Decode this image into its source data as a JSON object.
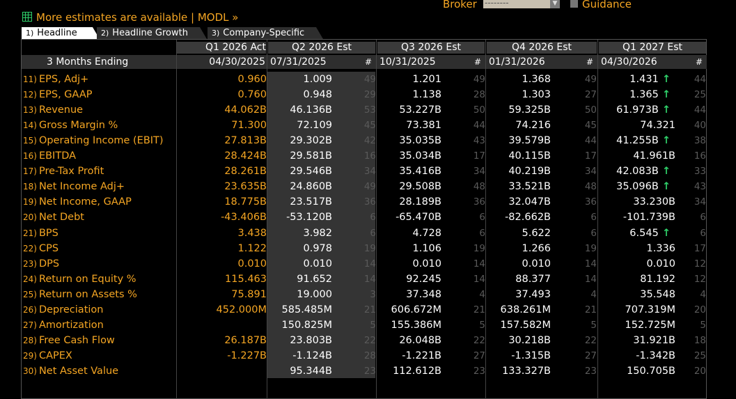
{
  "topbar": {
    "more_link": "More estimates are available | MODL »",
    "broker_label": "Broker",
    "broker_value": "--------",
    "guidance_label": "Guidance"
  },
  "tabs": [
    {
      "num": "1)",
      "label": "Headline"
    },
    {
      "num": "2)",
      "label": "Headline Growth"
    },
    {
      "num": "3)",
      "label": "Company-Specific"
    }
  ],
  "header": {
    "row_label": "3 Months Ending",
    "count_symbol": "#",
    "columns": [
      {
        "title": "Q1 2026 Act",
        "date": "04/30/2025"
      },
      {
        "title": "Q2 2026 Est",
        "date": "07/31/2025"
      },
      {
        "title": "Q3 2026 Est",
        "date": "10/31/2025"
      },
      {
        "title": "Q4 2026 Est",
        "date": "01/31/2026"
      },
      {
        "title": "Q1 2027 Est",
        "date": "04/30/2026"
      }
    ]
  },
  "rows": [
    {
      "num": "11)",
      "label": "EPS, Adj+",
      "act": "0.960",
      "q2": "1.009",
      "c2": "49",
      "q3": "1.201",
      "c3": "49",
      "q4": "1.368",
      "c4": "49",
      "q5": "1.431",
      "c5": "44",
      "up": true
    },
    {
      "num": "12)",
      "label": "EPS, GAAP",
      "act": "0.760",
      "q2": "0.948",
      "c2": "29",
      "q3": "1.138",
      "c3": "28",
      "q4": "1.303",
      "c4": "27",
      "q5": "1.365",
      "c5": "25",
      "up": true
    },
    {
      "num": "13)",
      "label": "Revenue",
      "act": "44.062B",
      "q2": "46.136B",
      "c2": "53",
      "q3": "53.227B",
      "c3": "50",
      "q4": "59.325B",
      "c4": "50",
      "q5": "61.973B",
      "c5": "44",
      "up": true
    },
    {
      "num": "14)",
      "label": "Gross Margin %",
      "act": "71.300",
      "q2": "72.109",
      "c2": "45",
      "q3": "73.381",
      "c3": "44",
      "q4": "74.216",
      "c4": "45",
      "q5": "74.321",
      "c5": "40",
      "up": false
    },
    {
      "num": "15)",
      "label": "Operating Income (EBIT)",
      "act": "27.813B",
      "q2": "29.302B",
      "c2": "42",
      "q3": "35.035B",
      "c3": "43",
      "q4": "39.579B",
      "c4": "44",
      "q5": "41.255B",
      "c5": "38",
      "up": true
    },
    {
      "num": "16)",
      "label": "EBITDA",
      "act": "28.424B",
      "q2": "29.581B",
      "c2": "16",
      "q3": "35.034B",
      "c3": "17",
      "q4": "40.115B",
      "c4": "17",
      "q5": "41.961B",
      "c5": "16",
      "up": false
    },
    {
      "num": "17)",
      "label": "Pre-Tax Profit",
      "act": "28.261B",
      "q2": "29.546B",
      "c2": "34",
      "q3": "35.416B",
      "c3": "34",
      "q4": "40.219B",
      "c4": "34",
      "q5": "42.083B",
      "c5": "33",
      "up": true
    },
    {
      "num": "18)",
      "label": "Net Income Adj+",
      "act": "23.635B",
      "q2": "24.860B",
      "c2": "49",
      "q3": "29.508B",
      "c3": "48",
      "q4": "33.521B",
      "c4": "48",
      "q5": "35.096B",
      "c5": "43",
      "up": true
    },
    {
      "num": "19)",
      "label": "Net Income, GAAP",
      "act": "18.775B",
      "q2": "23.517B",
      "c2": "36",
      "q3": "28.189B",
      "c3": "36",
      "q4": "32.047B",
      "c4": "36",
      "q5": "33.230B",
      "c5": "34",
      "up": false
    },
    {
      "num": "20)",
      "label": "Net Debt",
      "act": "-43.406B",
      "q2": "-53.120B",
      "c2": "6",
      "q3": "-65.470B",
      "c3": "6",
      "q4": "-82.662B",
      "c4": "6",
      "q5": "-101.739B",
      "c5": "6",
      "up": false
    },
    {
      "num": "21)",
      "label": "BPS",
      "act": "3.438",
      "q2": "3.982",
      "c2": "6",
      "q3": "4.728",
      "c3": "6",
      "q4": "5.622",
      "c4": "6",
      "q5": "6.545",
      "c5": "6",
      "up": true
    },
    {
      "num": "22)",
      "label": "CPS",
      "act": "1.122",
      "q2": "0.978",
      "c2": "19",
      "q3": "1.106",
      "c3": "19",
      "q4": "1.266",
      "c4": "19",
      "q5": "1.336",
      "c5": "17",
      "up": false
    },
    {
      "num": "23)",
      "label": "DPS",
      "act": "0.010",
      "q2": "0.010",
      "c2": "14",
      "q3": "0.010",
      "c3": "14",
      "q4": "0.010",
      "c4": "14",
      "q5": "0.010",
      "c5": "12",
      "up": false
    },
    {
      "num": "24)",
      "label": "Return on Equity %",
      "act": "115.463",
      "q2": "91.652",
      "c2": "14",
      "q3": "92.245",
      "c3": "14",
      "q4": "88.377",
      "c4": "14",
      "q5": "81.192",
      "c5": "12",
      "up": false
    },
    {
      "num": "25)",
      "label": "Return on Assets %",
      "act": "75.891",
      "q2": "19.000",
      "c2": "3",
      "q3": "37.348",
      "c3": "4",
      "q4": "37.493",
      "c4": "4",
      "q5": "35.548",
      "c5": "4",
      "up": false
    },
    {
      "num": "26)",
      "label": "Depreciation",
      "act": "452.000M",
      "q2": "585.485M",
      "c2": "21",
      "q3": "606.672M",
      "c3": "21",
      "q4": "638.261M",
      "c4": "21",
      "q5": "707.319M",
      "c5": "20",
      "up": false
    },
    {
      "num": "27)",
      "label": "Amortization",
      "act": "",
      "q2": "150.825M",
      "c2": "5",
      "q3": "155.386M",
      "c3": "5",
      "q4": "157.582M",
      "c4": "5",
      "q5": "152.725M",
      "c5": "5",
      "up": false
    },
    {
      "num": "28)",
      "label": "Free Cash Flow",
      "act": "26.187B",
      "q2": "23.803B",
      "c2": "22",
      "q3": "26.048B",
      "c3": "22",
      "q4": "30.218B",
      "c4": "22",
      "q5": "31.921B",
      "c5": "18",
      "up": false
    },
    {
      "num": "29)",
      "label": "CAPEX",
      "act": "-1.227B",
      "q2": "-1.124B",
      "c2": "28",
      "q3": "-1.221B",
      "c3": "27",
      "q4": "-1.315B",
      "c4": "27",
      "q5": "-1.342B",
      "c5": "25",
      "up": false
    },
    {
      "num": "30)",
      "label": "Net Asset Value",
      "act": "",
      "q2": "95.344B",
      "c2": "23",
      "q3": "112.612B",
      "c3": "23",
      "q4": "133.327B",
      "c4": "23",
      "q5": "150.705B",
      "c5": "20",
      "up": false
    }
  ],
  "colors": {
    "label": "#f5a623",
    "up_arrow": "#2fd06a",
    "count": "#5a5a5a",
    "highlight_col": "#343434"
  }
}
